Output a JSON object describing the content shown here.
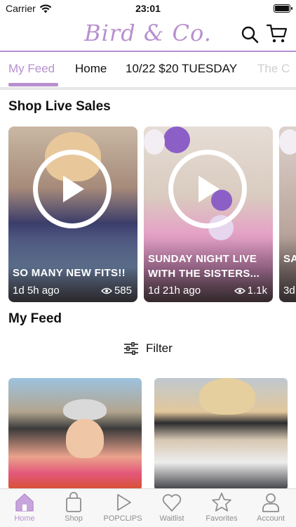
{
  "status_bar": {
    "carrier": "Carrier",
    "time": "23:01",
    "battery_percent": 100
  },
  "header": {
    "logo": "Bird & Co.",
    "search_icon": "search-icon",
    "cart_icon": "cart-icon",
    "accent_color": "#b890cf"
  },
  "tabs": [
    {
      "label": "My Feed",
      "active": true
    },
    {
      "label": "Home",
      "active": false
    },
    {
      "label": "10/22 $20 TUESDAY",
      "active": false
    },
    {
      "label": "The C",
      "active": false
    }
  ],
  "live_section": {
    "title": "Shop Live Sales",
    "cards": [
      {
        "title": "SO MANY NEW FITS!!",
        "ago": "1d 5h ago",
        "views": "585"
      },
      {
        "title": "SUNDAY NIGHT LIVE WITH THE SISTERS...",
        "ago": "1d 21h ago",
        "views": "1.1k"
      },
      {
        "title": "SA MO",
        "ago": "3d",
        "views": ""
      }
    ]
  },
  "feed_section": {
    "title": "My Feed",
    "filter_label": "Filter"
  },
  "tabbar": [
    {
      "label": "Home",
      "icon": "home-icon",
      "active": true
    },
    {
      "label": "Shop",
      "icon": "shopping-bag-icon",
      "active": false
    },
    {
      "label": "POPCLIPS",
      "icon": "play-icon",
      "active": false
    },
    {
      "label": "Waitlist",
      "icon": "heart-icon",
      "active": false
    },
    {
      "label": "Favorites",
      "icon": "star-icon",
      "active": false
    },
    {
      "label": "Account",
      "icon": "person-icon",
      "active": false
    }
  ]
}
